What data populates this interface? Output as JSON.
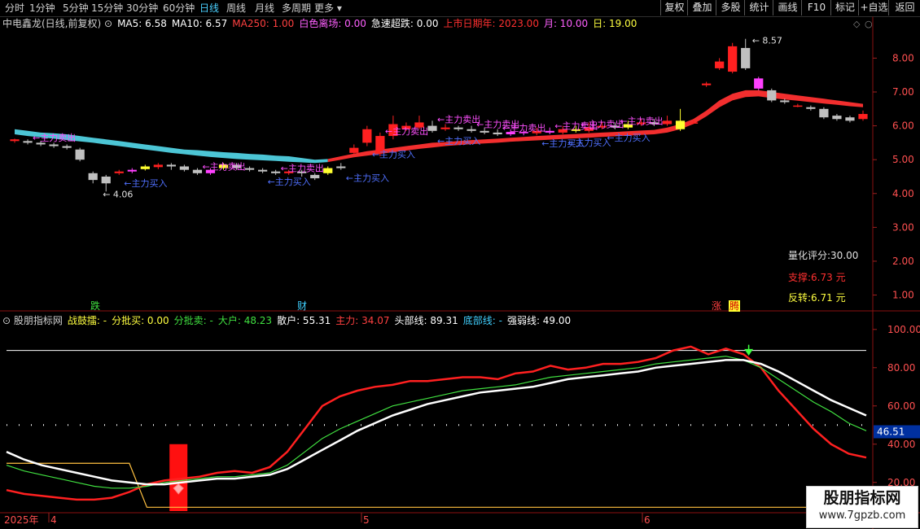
{
  "toolbar": {
    "periods": [
      "分时",
      "1分钟",
      "5分钟",
      "15分钟",
      "30分钟",
      "60分钟",
      "日线",
      "周线",
      "月线",
      "多周期",
      "更多"
    ],
    "active": "日线",
    "buttons": [
      "复权",
      "叠加",
      "多股",
      "统计",
      "画线",
      "F10",
      "标记",
      "+自选",
      "返回"
    ]
  },
  "price_header": {
    "stock": "中电鑫龙(日线,前复权)",
    "items": [
      {
        "label": "MA5: 6.58",
        "color": "#ffffff"
      },
      {
        "label": "MA10: 6.57",
        "color": "#ffffff"
      },
      {
        "label": "MA250: 1.00",
        "color": "#ff4040"
      },
      {
        "label": "白色离场: 0.00",
        "color": "#ff60ff"
      },
      {
        "label": "急速超跌: 0.00",
        "color": "#ffffff"
      },
      {
        "label": "上市日期年: 2023.00",
        "color": "#ff3030"
      },
      {
        "label": "月: 10.00",
        "color": "#ff60ff"
      },
      {
        "label": "日: 19.00",
        "color": "#ffff40"
      }
    ]
  },
  "indicator_header": {
    "title": "股朋指标网",
    "items": [
      {
        "label": "战鼓擂: -",
        "color": "#ffff40"
      },
      {
        "label": "分批买: 0.00",
        "color": "#ffff40"
      },
      {
        "label": "分批卖: -",
        "color": "#40e040"
      },
      {
        "label": "大户: 48.23",
        "color": "#40e040"
      },
      {
        "label": "散户: 55.31",
        "color": "#ffffff"
      },
      {
        "label": "主力: 34.07",
        "color": "#ff4040"
      },
      {
        "label": "头部线: 89.31",
        "color": "#ffffff"
      },
      {
        "label": "底部线: -",
        "color": "#40d0ff"
      },
      {
        "label": "强弱线: 49.00",
        "color": "#ffffff"
      }
    ]
  },
  "info_panel": {
    "score": "量化评分:30.00",
    "support": "支撑:6.73 元",
    "reversal": "反转:6.71 元"
  },
  "markers": {
    "die": "跌",
    "cai": "财",
    "zhang": "涨",
    "teng": "腾"
  },
  "annotations": {
    "high": "8.57",
    "low": "4.06",
    "sell": "主力卖出",
    "buy": "主力买入"
  },
  "x_labels": [
    "2025年",
    "4",
    "5",
    "6"
  ],
  "last_value_badge": "46.51",
  "watermark": {
    "line1": "股朋指标网",
    "line2": "www.7gpzb.com"
  },
  "colors": {
    "up": "#ff2020",
    "down": "#c0c0c0",
    "cloud_blue": "#50d0e0",
    "cloud_red": "#ff3030",
    "highlight": "#ffff30",
    "magenta": "#ff40ff"
  },
  "chart_data": [
    {
      "type": "candlestick",
      "yaxis_ticks": [
        1.0,
        2.0,
        3.0,
        4.0,
        5.0,
        6.0,
        7.0,
        8.0
      ],
      "ylim": [
        0.7,
        8.9
      ],
      "candles": [
        [
          5.55,
          5.6,
          5.5,
          5.62
        ],
        [
          5.55,
          5.5,
          5.45,
          5.6
        ],
        [
          5.5,
          5.45,
          5.4,
          5.55
        ],
        [
          5.45,
          5.4,
          5.35,
          5.5
        ],
        [
          5.4,
          5.35,
          5.3,
          5.45
        ],
        [
          5.3,
          5.0,
          4.95,
          5.35
        ],
        [
          4.6,
          4.4,
          4.3,
          4.65
        ],
        [
          4.5,
          4.3,
          4.06,
          4.55
        ],
        [
          4.6,
          4.65,
          4.55,
          4.7
        ],
        [
          4.65,
          4.7,
          4.6,
          4.75
        ],
        [
          4.72,
          4.8,
          4.68,
          4.85
        ],
        [
          4.78,
          4.85,
          4.72,
          4.9
        ],
        [
          4.85,
          4.8,
          4.7,
          4.9
        ],
        [
          4.8,
          4.7,
          4.65,
          4.85
        ],
        [
          4.7,
          4.6,
          4.55,
          4.75
        ],
        [
          4.6,
          4.7,
          4.55,
          4.75
        ],
        [
          4.75,
          4.85,
          4.7,
          4.9
        ],
        [
          4.85,
          4.75,
          4.7,
          4.9
        ],
        [
          4.75,
          4.7,
          4.65,
          4.8
        ],
        [
          4.7,
          4.65,
          4.6,
          4.75
        ],
        [
          4.65,
          4.6,
          4.55,
          4.7
        ],
        [
          4.6,
          4.65,
          4.55,
          4.7
        ],
        [
          4.65,
          4.6,
          4.5,
          4.7
        ],
        [
          4.55,
          4.45,
          4.4,
          4.6
        ],
        [
          4.6,
          4.75,
          4.55,
          4.8
        ],
        [
          4.8,
          4.75,
          4.7,
          4.9
        ],
        [
          5.2,
          5.35,
          5.15,
          5.45
        ],
        [
          5.5,
          5.9,
          5.4,
          6.0
        ],
        [
          5.2,
          5.7,
          5.1,
          5.8
        ],
        [
          5.7,
          6.05,
          5.6,
          6.3
        ],
        [
          5.9,
          6.0,
          5.85,
          6.1
        ],
        [
          5.95,
          6.1,
          5.9,
          6.3
        ],
        [
          6.0,
          5.85,
          5.8,
          6.15
        ],
        [
          5.9,
          5.95,
          5.85,
          6.05
        ],
        [
          5.95,
          5.9,
          5.85,
          6.0
        ],
        [
          5.9,
          5.85,
          5.8,
          6.0
        ],
        [
          5.85,
          5.8,
          5.75,
          5.95
        ],
        [
          5.8,
          5.75,
          5.7,
          5.9
        ],
        [
          5.75,
          5.82,
          5.7,
          5.9
        ],
        [
          5.82,
          5.78,
          5.72,
          5.9
        ],
        [
          5.78,
          5.85,
          5.72,
          5.95
        ],
        [
          5.85,
          5.8,
          5.75,
          5.95
        ],
        [
          5.8,
          5.9,
          5.75,
          6.0
        ],
        [
          5.9,
          5.85,
          5.8,
          6.0
        ],
        [
          5.85,
          5.95,
          5.8,
          6.1
        ],
        [
          5.95,
          6.0,
          5.9,
          6.1
        ],
        [
          6.0,
          5.95,
          5.9,
          6.1
        ],
        [
          5.95,
          6.05,
          5.9,
          6.15
        ],
        [
          6.05,
          6.1,
          6.0,
          6.2
        ],
        [
          6.1,
          6.05,
          6.0,
          6.2
        ],
        [
          6.05,
          6.15,
          6.0,
          6.3
        ],
        [
          6.15,
          5.9,
          5.85,
          6.5
        ],
        [
          6.1,
          6.1,
          6.05,
          6.2
        ],
        [
          7.2,
          7.25,
          7.15,
          7.3
        ],
        [
          7.7,
          7.9,
          7.65,
          8.0
        ],
        [
          7.6,
          8.35,
          7.55,
          8.45
        ],
        [
          8.3,
          7.7,
          7.65,
          8.57
        ],
        [
          7.4,
          7.1,
          7.05,
          7.45
        ],
        [
          7.05,
          6.75,
          6.7,
          7.1
        ],
        [
          6.75,
          6.7,
          6.65,
          6.8
        ],
        [
          6.6,
          6.6,
          6.55,
          6.65
        ],
        [
          6.55,
          6.5,
          6.45,
          6.6
        ],
        [
          6.5,
          6.25,
          6.2,
          6.55
        ],
        [
          6.3,
          6.2,
          6.15,
          6.35
        ],
        [
          6.25,
          6.15,
          6.1,
          6.3
        ],
        [
          6.2,
          6.35,
          6.15,
          6.45
        ]
      ],
      "cloud_upper": [
        5.9,
        5.85,
        5.8,
        5.78,
        5.75,
        5.7,
        5.65,
        5.6,
        5.55,
        5.5,
        5.45,
        5.4,
        5.35,
        5.3,
        5.28,
        5.25,
        5.22,
        5.2,
        5.17,
        5.15,
        5.12,
        5.1,
        5.05,
        5.0,
        5.02,
        5.1,
        5.18,
        5.25,
        5.3,
        5.35,
        5.4,
        5.45,
        5.5,
        5.52,
        5.55,
        5.58,
        5.6,
        5.62,
        5.65,
        5.67,
        5.7,
        5.72,
        5.74,
        5.76,
        5.78,
        5.8,
        5.82,
        5.84,
        5.86,
        5.88,
        5.95,
        6.05,
        6.2,
        6.45,
        6.75,
        6.95,
        7.05,
        7.05,
        7.0,
        6.95,
        6.9,
        6.85,
        6.8,
        6.75,
        6.7,
        6.65
      ],
      "cloud_lower": [
        5.75,
        5.7,
        5.66,
        5.62,
        5.58,
        5.54,
        5.5,
        5.45,
        5.4,
        5.35,
        5.3,
        5.25,
        5.2,
        5.16,
        5.12,
        5.08,
        5.05,
        5.02,
        5.0,
        4.98,
        4.96,
        4.94,
        4.92,
        4.9,
        4.93,
        5.0,
        5.07,
        5.12,
        5.17,
        5.22,
        5.27,
        5.32,
        5.36,
        5.4,
        5.43,
        5.46,
        5.48,
        5.5,
        5.53,
        5.55,
        5.57,
        5.59,
        5.61,
        5.63,
        5.65,
        5.67,
        5.69,
        5.71,
        5.73,
        5.75,
        5.8,
        5.9,
        6.05,
        6.28,
        6.55,
        6.75,
        6.85,
        6.87,
        6.82,
        6.78,
        6.74,
        6.7,
        6.66,
        6.62,
        6.58,
        6.55
      ]
    },
    {
      "type": "line",
      "yaxis_ticks": [
        20.0,
        40.0,
        60.0,
        80.0,
        100.0
      ],
      "ylim": [
        5,
        108
      ],
      "reference_lines": [
        {
          "value": 89,
          "color": "#ffffff"
        },
        {
          "value": 50,
          "color": "#ffffff",
          "dotted": true
        }
      ],
      "series": [
        {
          "color": "#ff2020",
          "values": [
            16,
            14,
            13,
            12,
            11,
            11,
            12,
            15,
            19,
            21,
            22,
            23,
            25,
            26,
            25,
            28,
            36,
            48,
            60,
            65,
            68,
            70,
            71,
            73,
            73,
            74,
            75,
            75,
            74,
            77,
            78,
            81,
            79,
            80,
            82,
            82,
            83,
            85,
            89,
            91,
            87,
            90,
            87,
            80,
            68,
            58,
            48,
            40,
            35,
            33
          ]
        },
        {
          "color": "#40e040",
          "values": [
            29,
            26,
            24,
            22,
            20,
            18,
            17,
            17,
            18,
            20,
            21,
            22,
            23,
            23,
            24,
            25,
            29,
            36,
            43,
            48,
            52,
            56,
            60,
            62,
            64,
            66,
            68,
            69,
            70,
            71,
            73,
            75,
            76,
            77,
            78,
            79,
            80,
            82,
            83,
            84,
            85,
            86,
            84,
            80,
            74,
            68,
            62,
            57,
            51,
            47
          ]
        },
        {
          "color": "#ffffff",
          "values": [
            36,
            32,
            29,
            27,
            25,
            23,
            21,
            20,
            19,
            19,
            20,
            21,
            22,
            22,
            23,
            24,
            27,
            32,
            37,
            42,
            47,
            51,
            55,
            58,
            61,
            63,
            65,
            67,
            68,
            69,
            70,
            72,
            74,
            75,
            76,
            77,
            78,
            80,
            81,
            82,
            83,
            84,
            84,
            82,
            78,
            73,
            68,
            63,
            59,
            55
          ]
        },
        {
          "color": "#ffc040",
          "values": [
            30,
            30,
            30,
            30,
            30,
            30,
            30,
            30,
            30,
            30,
            30,
            30,
            30,
            30,
            30,
            30,
            30,
            30,
            30,
            30,
            30,
            30,
            30,
            30,
            30,
            30,
            30,
            30,
            30,
            30,
            30,
            30,
            30,
            30,
            30,
            30,
            30,
            30,
            30,
            30,
            30,
            30,
            30,
            30,
            30,
            30,
            30,
            30,
            30,
            30
          ]
        }
      ],
      "signal_bar_value": 40
    }
  ]
}
